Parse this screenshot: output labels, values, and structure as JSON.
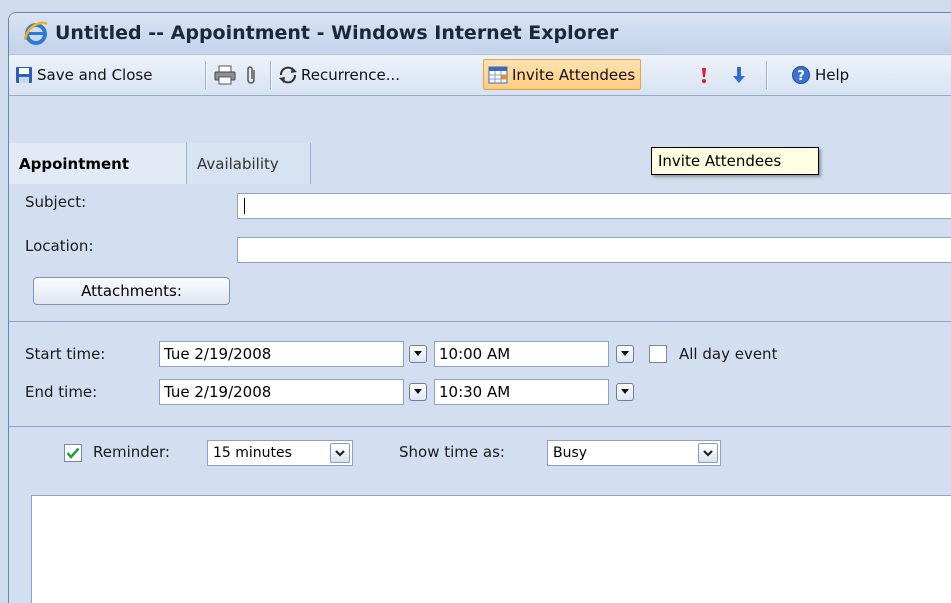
{
  "window": {
    "title": "Untitled -- Appointment - Windows Internet Explorer",
    "icon": "ie-logo-icon"
  },
  "toolbar": {
    "save_close_label": "Save and Close",
    "print_icon": "printer-icon",
    "attach_icon": "paperclip-icon",
    "recurrence_label": "Recurrence...",
    "invite_label": "Invite Attendees",
    "importance_high_icon": "exclamation-icon",
    "importance_low_icon": "down-arrow-icon",
    "help_label": "Help",
    "hot_color": "#ffcd82"
  },
  "tabs": {
    "appointment": "Appointment",
    "availability": "Availability"
  },
  "tooltip": "Invite Attendees",
  "form": {
    "subject_label": "Subject:",
    "subject_value": "",
    "location_label": "Location:",
    "location_value": "",
    "attachments_label": "Attachments:",
    "start_label": "Start time:",
    "start_date": "Tue 2/19/2008",
    "start_time": "10:00 AM",
    "end_label": "End time:",
    "end_date": "Tue 2/19/2008",
    "end_time": "10:30 AM",
    "all_day_label": "All day event",
    "all_day_checked": false,
    "reminder_label": "Reminder:",
    "reminder_checked": true,
    "reminder_value": "15 minutes",
    "show_time_label": "Show time as:",
    "show_time_value": "Busy"
  }
}
